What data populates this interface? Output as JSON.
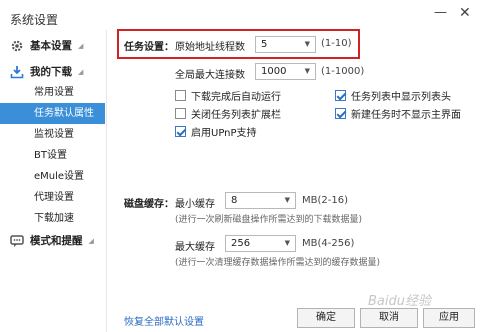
{
  "window": {
    "title": "系统设置",
    "minimize_icon": "minimize-icon",
    "close_icon": "close-icon"
  },
  "sidebar": {
    "groups": [
      {
        "label": "基本设置",
        "icon": "gear-icon"
      },
      {
        "label": "我的下载",
        "icon": "download-icon"
      },
      {
        "label": "模式和提醒",
        "icon": "chat-icon"
      }
    ],
    "items": [
      {
        "label": "常用设置"
      },
      {
        "label": "任务默认属性"
      },
      {
        "label": "监视设置"
      },
      {
        "label": "BT设置"
      },
      {
        "label": "eMule设置"
      },
      {
        "label": "代理设置"
      },
      {
        "label": "下载加速"
      }
    ]
  },
  "task_settings": {
    "section_label": "任务设置：",
    "threads_label": "原始地址线程数",
    "threads_value": "5",
    "threads_range": "(1-10)",
    "max_conn_label": "全局最大连接数",
    "max_conn_value": "1000",
    "max_conn_range": "(1-1000)"
  },
  "options": [
    {
      "label": "下载完成后自动运行",
      "checked": false
    },
    {
      "label": "任务列表中显示列表头",
      "checked": true
    },
    {
      "label": "关闭任务列表扩展栏",
      "checked": false
    },
    {
      "label": "新建任务时不显示主界面",
      "checked": true
    },
    {
      "label": "启用UPnP支持",
      "checked": true
    }
  ],
  "disk_cache": {
    "section_label": "磁盘缓存：",
    "min_label": "最小缓存",
    "min_value": "8",
    "min_unit": "MB(2-16)",
    "min_hint": "(进行一次刷新磁盘操作所需达到的下载数据量)",
    "max_label": "最大缓存",
    "max_value": "256",
    "max_unit": "MB(4-256)",
    "max_hint": "(进行一次清理缓存数据操作所需达到的缓存数据量)"
  },
  "footer": {
    "restore_link": "恢复全部默认设置",
    "ok": "确定",
    "cancel": "取消",
    "apply": "应用"
  },
  "watermark": "Baidu经验"
}
